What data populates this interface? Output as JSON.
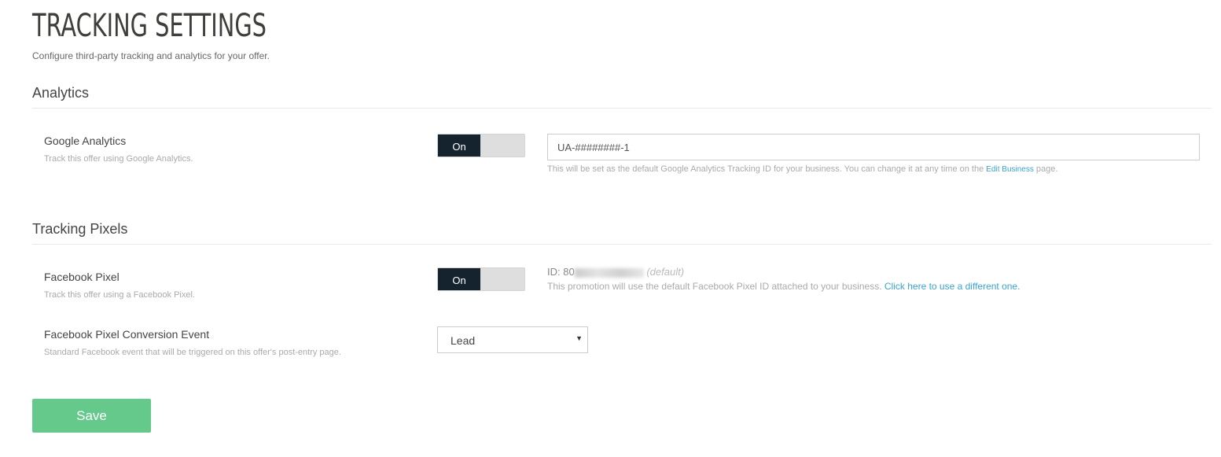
{
  "header": {
    "title": "TRACKING SETTINGS",
    "subtitle": "Configure third-party tracking and analytics for your offer."
  },
  "analytics": {
    "heading": "Analytics",
    "google": {
      "label": "Google Analytics",
      "desc": "Track this offer using Google Analytics.",
      "toggle": "On",
      "enabled": true,
      "value": "UA-########-1",
      "help_pre": "This will be set as the default Google Analytics Tracking ID for your business. You can change it at any time on the ",
      "help_link": "Edit Business",
      "help_post": " page."
    }
  },
  "pixels": {
    "heading": "Tracking Pixels",
    "facebook": {
      "label": "Facebook Pixel",
      "desc": "Track this offer using a Facebook Pixel.",
      "toggle": "On",
      "enabled": true,
      "id_prefix": "ID: 80",
      "id_suffix": "default)",
      "help": "This promotion will use the default Facebook Pixel ID attached to your business. ",
      "help_link": "Click here to use a different one."
    },
    "event": {
      "label": "Facebook Pixel Conversion Event",
      "desc": "Standard Facebook event that will be triggered on this offer's post-entry page.",
      "selected": "Lead"
    }
  },
  "save_label": "Save",
  "colors": {
    "toggle_on": "#14232e",
    "save": "#66c98c",
    "link": "#3ba3d0"
  }
}
